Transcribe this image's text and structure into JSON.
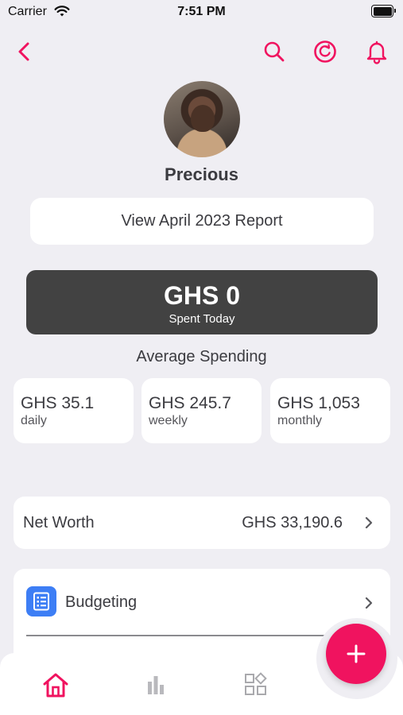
{
  "status_bar": {
    "carrier": "Carrier",
    "time": "7:51 PM"
  },
  "colors": {
    "accent": "#f0135f",
    "dark_card": "#424242",
    "budget_icon": "#3d7ef5",
    "background": "#efeef3"
  },
  "nav": {
    "icons": [
      "chevron-left-icon",
      "search-icon",
      "refresh-coin-icon",
      "bell-icon"
    ]
  },
  "profile": {
    "name": "Precious"
  },
  "report_button": {
    "label": "View April 2023 Report"
  },
  "spent": {
    "amount": "GHS 0",
    "label": "Spent Today"
  },
  "average_spending": {
    "title": "Average Spending",
    "cards": [
      {
        "value": "GHS 35.1",
        "period": "daily"
      },
      {
        "value": "GHS 245.7",
        "period": "weekly"
      },
      {
        "value": "GHS 1,053",
        "period": "monthly"
      }
    ]
  },
  "net_worth": {
    "label": "Net Worth",
    "value": "GHS 33,190.6"
  },
  "menu": {
    "budgeting_label": "Budgeting"
  },
  "tab_bar": {
    "icons": [
      "home-icon",
      "bar-chart-icon",
      "apps-grid-icon"
    ],
    "active": "home"
  },
  "fab": {
    "icon": "plus-icon"
  }
}
